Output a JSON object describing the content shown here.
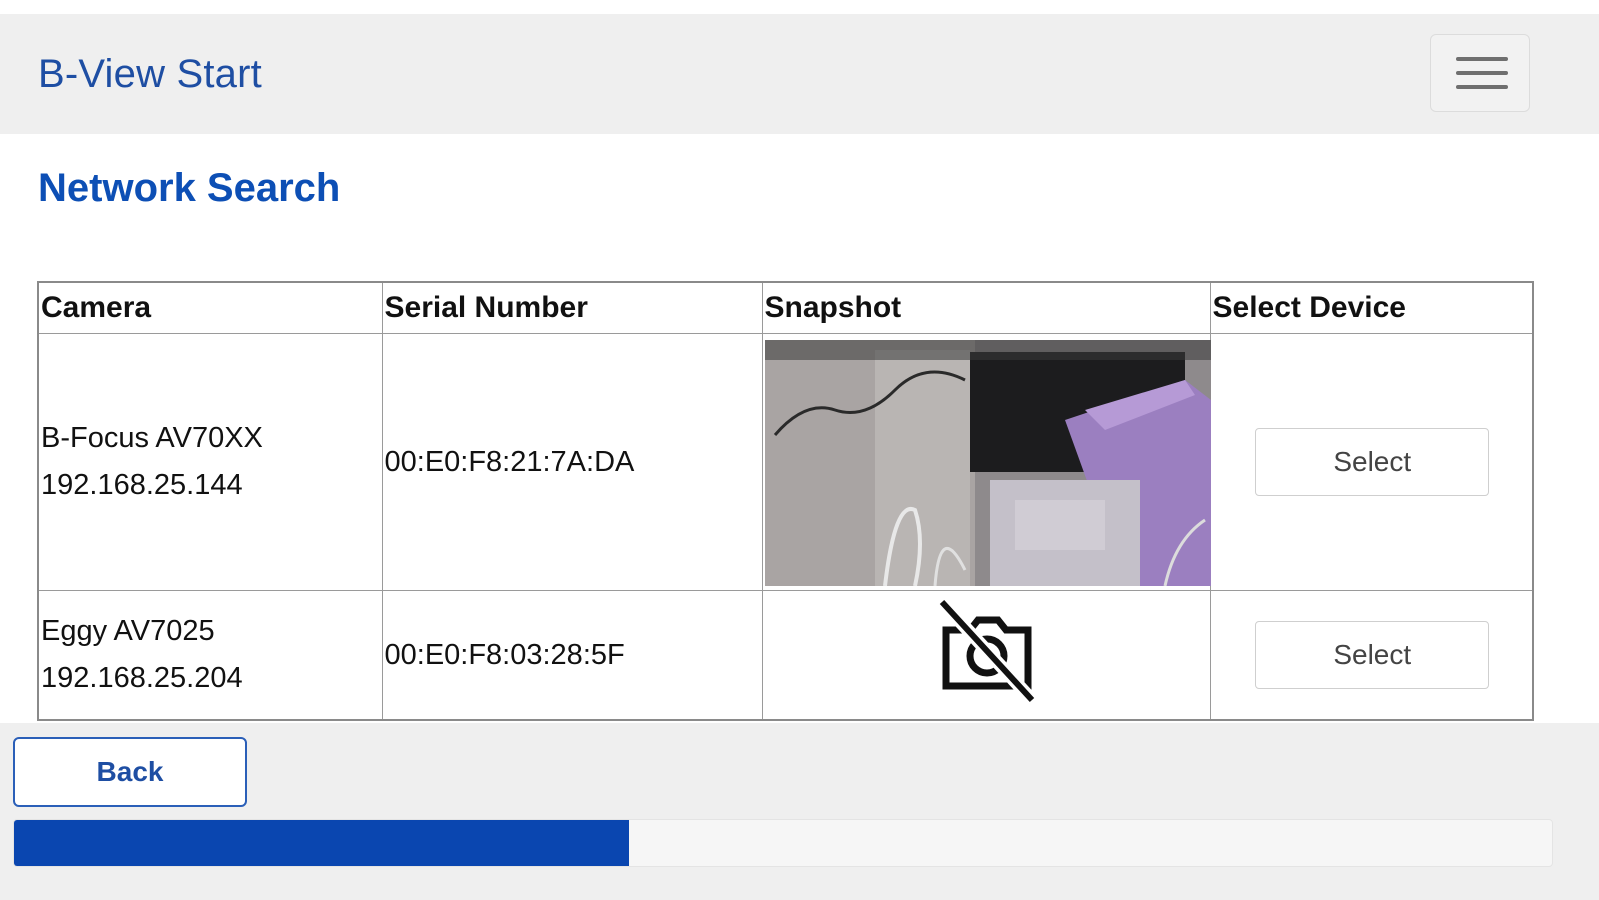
{
  "header": {
    "title": "B-View Start",
    "menu_icon": "hamburger-menu-icon"
  },
  "page": {
    "section_title": "Network Search"
  },
  "table": {
    "columns": [
      "Camera",
      "Serial Number",
      "Snapshot",
      "Select Device"
    ],
    "rows": [
      {
        "camera_name": "B-Focus AV70XX",
        "camera_ip": "192.168.25.144",
        "serial": "00:E0:F8:21:7A:DA",
        "snapshot": "camera-snapshot-image",
        "select_label": "Select"
      },
      {
        "camera_name": "Eggy AV7025",
        "camera_ip": "192.168.25.204",
        "serial": "00:E0:F8:03:28:5F",
        "snapshot": "no-image-icon",
        "select_label": "Select"
      }
    ]
  },
  "footer": {
    "back_label": "Back",
    "progress": 0.4
  },
  "colors": {
    "accent": "#1e4ea3",
    "progress": "#0a46b0",
    "header_bg": "#efefef"
  }
}
